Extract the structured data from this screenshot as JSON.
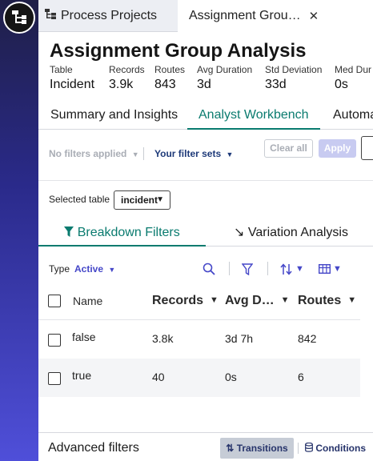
{
  "rail": {
    "logo_icon": "process-tree-logo-icon"
  },
  "tabs": {
    "process_projects": "Process Projects",
    "active_tab": "Assignment Grou…"
  },
  "header": {
    "title": "Assignment Group Analysis",
    "stats": [
      {
        "label": "Table",
        "value": "Incident"
      },
      {
        "label": "Records",
        "value": "3.9k"
      },
      {
        "label": "Routes",
        "value": "843"
      },
      {
        "label": "Avg Duration",
        "value": "3d"
      },
      {
        "label": "Std Deviation",
        "value": "33d"
      },
      {
        "label": "Med Dur",
        "value": "0s"
      }
    ]
  },
  "nav_tabs": [
    "Summary and Insights",
    "Analyst Workbench",
    "Automa"
  ],
  "filter_bar": {
    "no_filters": "No filters applied",
    "filter_sets": "Your filter sets",
    "clear_all": "Clear all",
    "apply": "Apply"
  },
  "selected_table": {
    "label": "Selected table",
    "value": "incident"
  },
  "breakdown_tabs": {
    "breakdown": "Breakdown Filters",
    "variation": "Variation Analysis"
  },
  "type_row": {
    "label": "Type",
    "value": "Active"
  },
  "table": {
    "columns": [
      "Name",
      "Records",
      "Avg D…",
      "Routes"
    ],
    "rows": [
      {
        "name": "false",
        "records": "3.8k",
        "avg": "3d 7h",
        "routes": "842"
      },
      {
        "name": "true",
        "records": "40",
        "avg": "0s",
        "routes": "6"
      }
    ]
  },
  "advanced": {
    "label": "Advanced filters",
    "transitions": "Transitions",
    "conditions": "Conditions"
  },
  "colors": {
    "accent_teal": "#0a7b6f",
    "accent_indigo": "#4547c8",
    "rail_top": "#1f1f47",
    "rail_bottom": "#4f4fd9"
  }
}
